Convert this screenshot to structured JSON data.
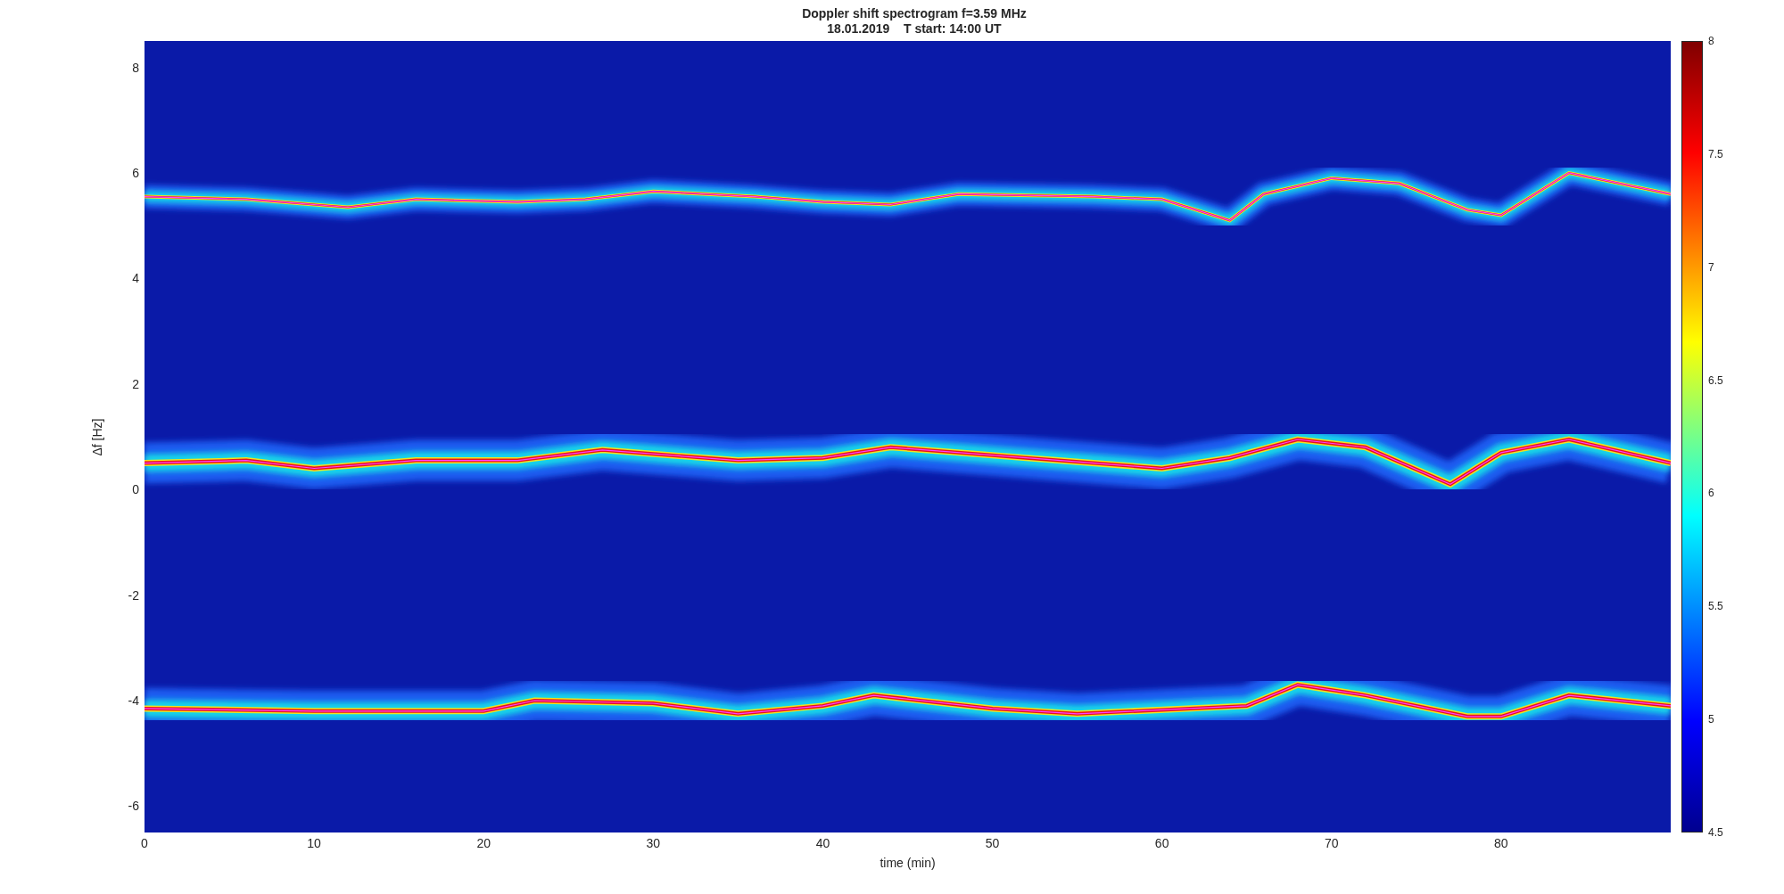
{
  "title": [
    "Doppler shift spectrogram f=3.59 MHz",
    "18.01.2019    T start: 14:00 UT"
  ],
  "ylabel": "Δf [Hz]",
  "xlabel": "time (min)",
  "yticks": [
    "8",
    "6",
    "4",
    "2",
    "0",
    "-2",
    "-4",
    "-6"
  ],
  "xticks": [
    "0",
    "10",
    "20",
    "30",
    "40",
    "50",
    "60",
    "70",
    "80"
  ],
  "colorbar_ticks": [
    "8",
    "7.5",
    "7",
    "6.5",
    "6",
    "5.5",
    "5",
    "4.5"
  ]
}
